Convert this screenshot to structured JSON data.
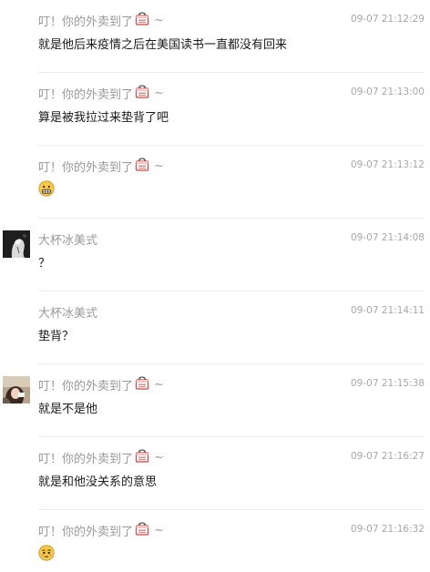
{
  "messages": [
    {
      "sender": "叮！你的外卖到了",
      "suffix": "~",
      "time": "09-07 21:12:29",
      "text": "就是他后来疫情之后在美国读书一直都没有回来",
      "avatar": "none",
      "emoji": null
    },
    {
      "sender": "叮！你的外卖到了",
      "suffix": "~",
      "time": "09-07 21:13:00",
      "text": "算是被我拉过来垫背了吧",
      "avatar": "none",
      "emoji": null
    },
    {
      "sender": "叮！你的外卖到了",
      "suffix": "~",
      "time": "09-07 21:13:12",
      "text": "",
      "avatar": "none",
      "emoji": "grimace-emoji"
    },
    {
      "sender": "大杯冰美式",
      "suffix": "",
      "time": "09-07 21:14:08",
      "text": "？",
      "avatar": "dark",
      "emoji": null
    },
    {
      "sender": "大杯冰美式",
      "suffix": "",
      "time": "09-07 21:14:11",
      "text": "垫背？",
      "avatar": "none",
      "emoji": null
    },
    {
      "sender": "叮！你的外卖到了",
      "suffix": "~",
      "time": "09-07 21:15:38",
      "text": "就是不是他",
      "avatar": "light",
      "emoji": null
    },
    {
      "sender": "叮！你的外卖到了",
      "suffix": "~",
      "time": "09-07 21:16:27",
      "text": "就是和他没关系的意思",
      "avatar": "none",
      "emoji": null
    },
    {
      "sender": "叮！你的外卖到了",
      "suffix": "~",
      "time": "09-07 21:16:32",
      "text": "",
      "avatar": "none",
      "emoji": "pleading-emoji"
    }
  ],
  "colors": {
    "name": "#9a9a9a",
    "time": "#a8a8a8",
    "text": "#1a1a1a",
    "divider": "#ececec",
    "bag_red": "#d9534f"
  }
}
